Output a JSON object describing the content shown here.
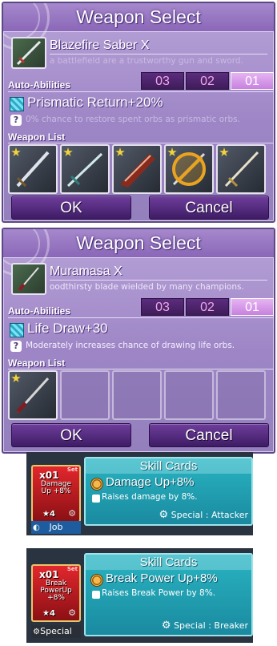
{
  "panels": [
    {
      "title": "Weapon Select",
      "weapon_name": "Blazefire Saber X",
      "weapon_desc": "a battlefield are a trustworthy gun and sword.",
      "auto_abilities_label": "Auto-Abilities",
      "slots": [
        "03",
        "02",
        "01"
      ],
      "active_slot": "01",
      "ability_name": "Prismatic Return+20%",
      "ability_desc": "0% chance to restore spent orbs as prismatic orbs.",
      "weapon_list_label": "Weapon List",
      "weapon_list": [
        "sword",
        "sword",
        "gunblade",
        "sword-equipped",
        "sword"
      ],
      "ok_label": "OK",
      "cancel_label": "Cancel"
    },
    {
      "title": "Weapon Select",
      "weapon_name": "Muramasa X",
      "weapon_desc": "oodthirsty blade wielded by many champions.",
      "auto_abilities_label": "Auto-Abilities",
      "slots": [
        "03",
        "02",
        "01"
      ],
      "active_slot": "01",
      "ability_name": "Life Draw+30",
      "ability_desc": "Moderately increases chance of drawing life orbs.",
      "weapon_list_label": "Weapon List",
      "weapon_list": [
        "katana",
        "",
        "",
        "",
        ""
      ],
      "ok_label": "OK",
      "cancel_label": "Cancel"
    }
  ],
  "skill_cards": [
    {
      "header": "Skill Cards",
      "skill_name": "Damage Up+8%",
      "skill_desc": "Raises damage by 8%.",
      "special_text": "Special : Attacker",
      "card_count": "x01",
      "card_overlay": "Damage Up +8%",
      "card_stars": "★4",
      "card_set": "Set",
      "card_type": "Job"
    },
    {
      "header": "Skill Cards",
      "skill_name": "Break Power Up+8%",
      "skill_desc": "Raises Break Power by 8%.",
      "special_text": "Special : Breaker",
      "card_count": "x01",
      "card_overlay": "Break PowerUp +8%",
      "card_stars": "★4",
      "card_set": "Set",
      "card_type": "Special"
    }
  ],
  "colors": {
    "panel_purple": "#9e86c6",
    "slot_active": "#d38fe6",
    "skill_teal": "#1a8aa0",
    "card_red": "#c81e24"
  }
}
